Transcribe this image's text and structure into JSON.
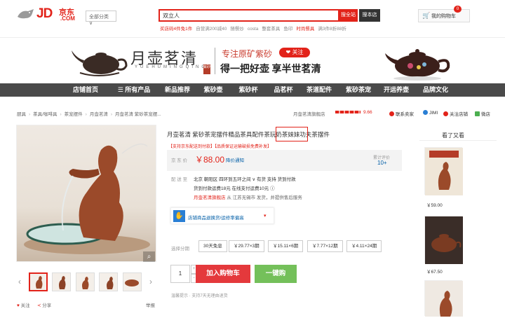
{
  "header": {
    "logo_text": "JD",
    "logo_cn": "京东",
    "logo_com": ".COM",
    "category_select": "全部分类",
    "search_value": "双立人",
    "search_all_button": "搜全站",
    "search_store_button": "搜本店",
    "hot_links": [
      "买店码4件免1件",
      "自营满200减40",
      "随餐炒",
      "costa",
      "整套茶具",
      "鱼印",
      "时尚餐具",
      "满3件8折88折"
    ],
    "cart_label": "我的购物车",
    "cart_count": "0"
  },
  "banner": {
    "brand_cn": "月壶茗清",
    "brand_en": "YUEHUMINGQING",
    "seal": "紫砂",
    "slogan1": "专注原矿紫砂",
    "follow_button": "❤ 关注",
    "slogan2": "得一把好壶 享半世茗清"
  },
  "nav": {
    "items": [
      "店铺首页",
      "☰ 所有产品",
      "新品推荐",
      "紫砂壶",
      "紫砂杯",
      "品茗杯",
      "茶道配件",
      "紫砂茶宠",
      "开运养壶",
      "品牌文化"
    ]
  },
  "breadcrumb": {
    "items": [
      "厨具",
      "茶具/咖啡具",
      "茶宠摆件",
      "月壶茗清",
      "月壶茗清 紫砂茶宠摆..."
    ],
    "shop_name": "月壶茗清旗舰店",
    "score": "9.66",
    "contact": "联系卖家",
    "jimi": "JIMI",
    "follow_shop": "关注店铺",
    "wechat": "微店"
  },
  "product": {
    "title": "月壶茗清 紫砂茶宠摆件精品茶具配件茶玩奶茶妹妹功夫茶摆件",
    "promo": "【支持京东配送到付款】【品质保证运输破损免费补发】",
    "price_label": "京 东 价",
    "price": "￥88.00",
    "price_note": "降价通知",
    "cumulative_label": "累计评价",
    "cumulative_value": "10+",
    "ship_label": "配 送 至",
    "ship_line1": "北京 朝阳区 四环到五环之间 ∨    有货    支持    货到付款",
    "ship_line2": "货到付款运费18元 在线支付运费10元 ⓘ",
    "ship_line3_red": "月壶茗清旗舰店",
    "ship_line3": "从 江苏无锡市 发货，并提供售后服务",
    "service": "店铺商品退换货/运修率偏高",
    "option_label": "选择分期",
    "options": [
      "30天免息",
      "￥29.77×3期",
      "￥15.11×6期",
      "￥7.77×12期",
      "￥4.11×24期"
    ],
    "quantity": "1",
    "add_to_cart": "加入购物车",
    "buy_now": "一键购",
    "tip": "温馨提示    · 支持7天无理由退货",
    "follow": "关注",
    "share": "分享",
    "report": "举报"
  },
  "seen_also": {
    "title": "看了又看",
    "items": [
      {
        "price": "￥59.00"
      },
      {
        "price": "￥67.50"
      }
    ]
  }
}
